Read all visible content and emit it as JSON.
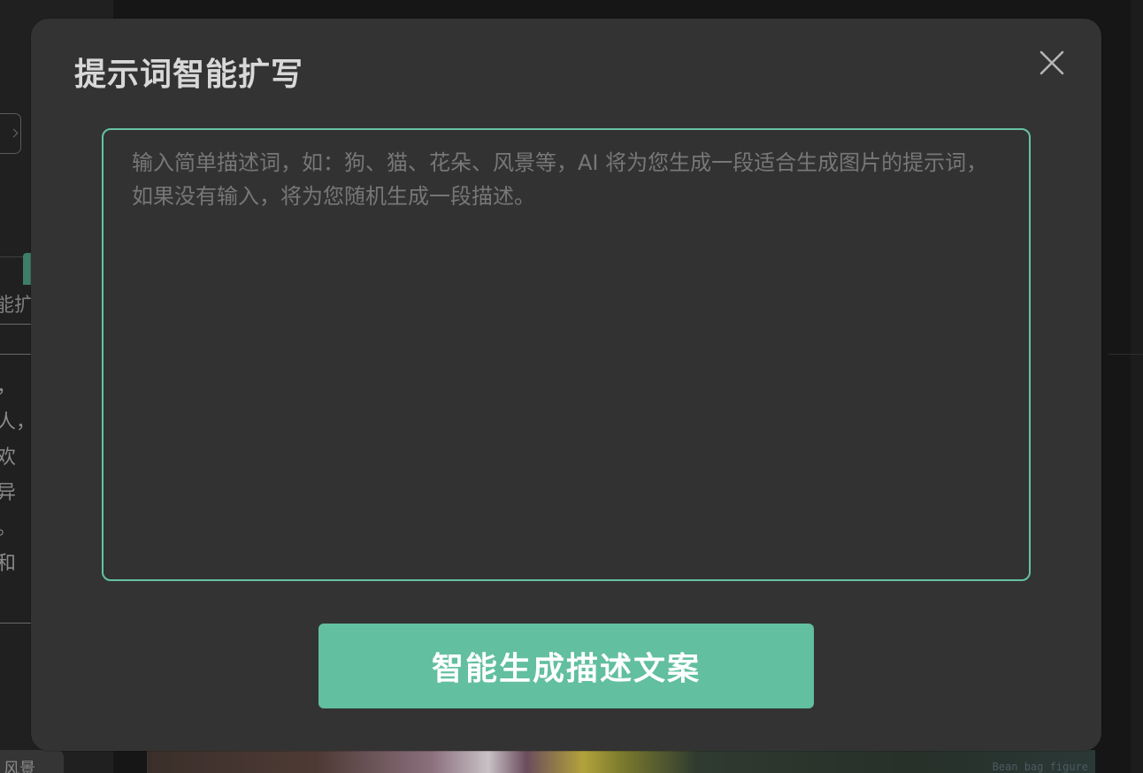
{
  "background": {
    "tab_text": "能扩",
    "text_fragments": [
      "，",
      "人，",
      "欢",
      "异",
      "。",
      "和"
    ],
    "bottom_tag": "风景",
    "image_caption": "Bean bag figure"
  },
  "modal": {
    "title": "提示词智能扩写",
    "close_icon": "close-icon",
    "prompt_placeholder": "输入简单描述词，如：狗、猫、花朵、风景等，AI 将为您生成一段适合生成图片的提示词，如果没有输入，将为您随机生成一段描述。",
    "prompt_value": "",
    "generate_button_label": "智能生成描述文案"
  },
  "colors": {
    "accent": "#62bf9f",
    "focus_border": "#66c2a0",
    "modal_bg": "#333333",
    "overlay_bg": "#1a1a1a"
  }
}
